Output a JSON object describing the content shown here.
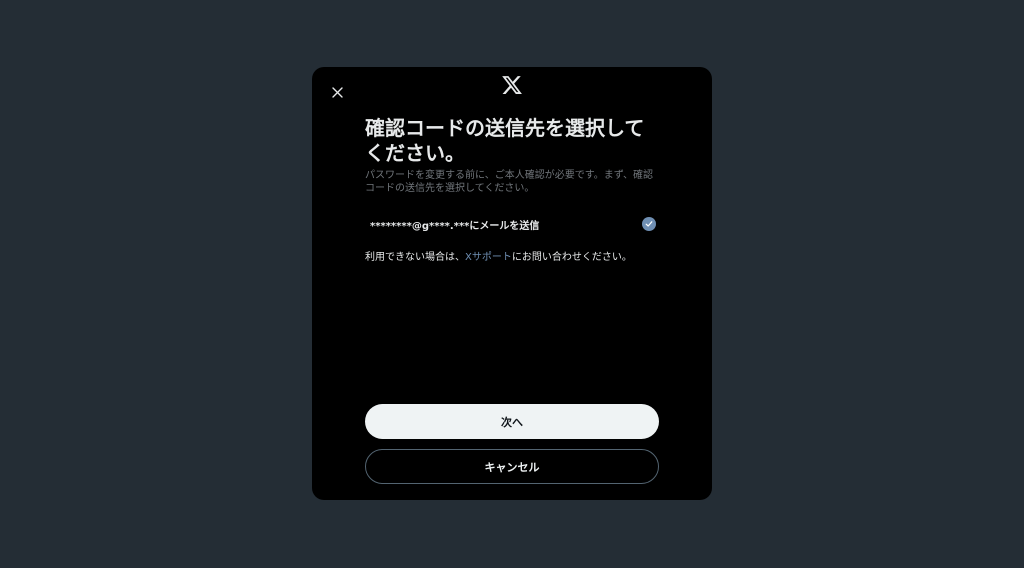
{
  "dialog": {
    "close_icon": "close-icon",
    "logo_icon": "x-logo-icon",
    "title": "確認コードの送信先を選択してください。",
    "subtitle": "パスワードを変更する前に、ご本人確認が必要です。まず、確認コードの送信先を選択してください。",
    "option": {
      "label": "********@g****.***にメールを送信",
      "selected": true,
      "check_icon": "check-circle-icon"
    },
    "help": {
      "prefix": "利用できない場合は、",
      "link": "Xサポート",
      "suffix": "にお問い合わせください。"
    },
    "next_label": "次へ",
    "cancel_label": "キャンセル"
  },
  "colors": {
    "backdrop": "#242d35",
    "modal": "#000000",
    "accent": "#6f8fb3",
    "primary_button": "#eff3f4"
  }
}
